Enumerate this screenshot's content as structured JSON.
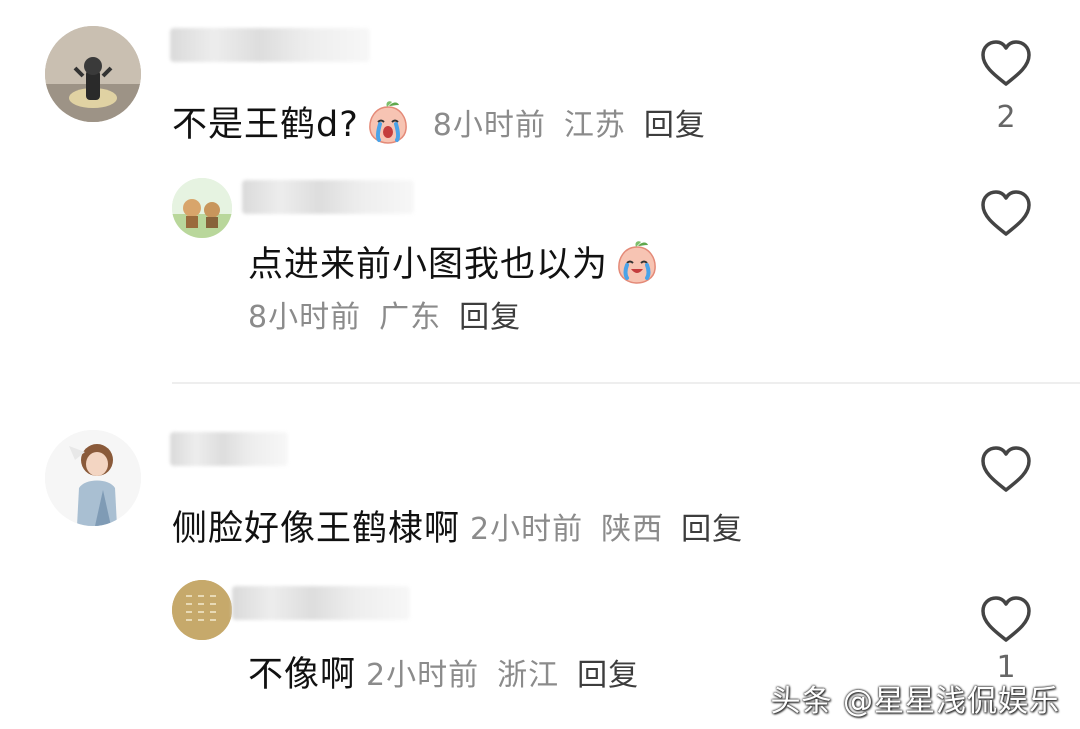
{
  "comments": [
    {
      "text": "不是王鹤d?",
      "emoji": "crying-peach-emoji",
      "time": "8小时前",
      "location": "江苏",
      "reply_label": "回复",
      "likes": "2"
    },
    {
      "text": "点进来前小图我也以为",
      "emoji": "crying-peach-emoji",
      "time": "8小时前",
      "location": "广东",
      "reply_label": "回复",
      "likes": ""
    },
    {
      "text": "侧脸好像王鹤棣啊",
      "time": "2小时前",
      "location": "陕西",
      "reply_label": "回复",
      "likes": ""
    },
    {
      "text": "不像啊",
      "time": "2小时前",
      "location": "浙江",
      "reply_label": "回复",
      "likes": "1"
    }
  ],
  "watermark": "头条 @星星浅侃娱乐",
  "colors": {
    "meta": "#8b8b8b",
    "text": "#111111",
    "divider": "#eeeeee"
  }
}
